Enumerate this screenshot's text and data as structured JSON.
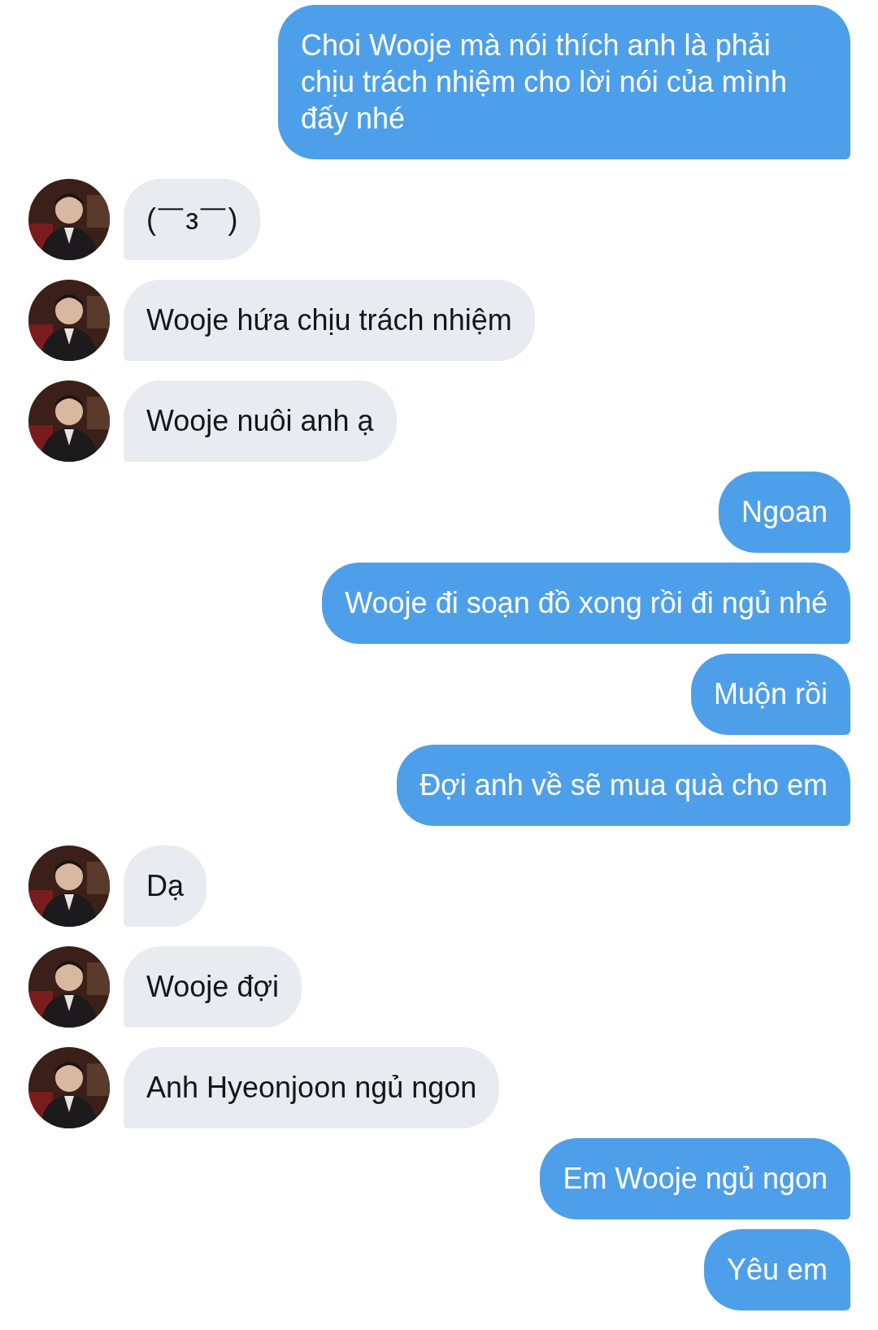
{
  "messages": [
    {
      "kind": "sent",
      "text": "Choi Wooje mà nói thích anh là phải chịu trách nhiệm cho lời nói của mình đấy nhé"
    },
    {
      "kind": "received",
      "text": "(￣з￣)"
    },
    {
      "kind": "received",
      "text": "Wooje hứa chịu trách nhiệm"
    },
    {
      "kind": "received",
      "text": "Wooje nuôi anh ạ"
    },
    {
      "kind": "sent",
      "text": "Ngoan"
    },
    {
      "kind": "sent",
      "text": "Wooje đi soạn đồ xong rồi đi ngủ nhé"
    },
    {
      "kind": "sent",
      "text": "Muộn rồi"
    },
    {
      "kind": "sent",
      "text": "Đợi anh về sẽ mua quà cho em"
    },
    {
      "kind": "received",
      "text": "Dạ"
    },
    {
      "kind": "received",
      "text": "Wooje đợi"
    },
    {
      "kind": "received",
      "text": "Anh Hyeonjoon ngủ ngon"
    },
    {
      "kind": "sent",
      "text": "Em Wooje ngủ ngon"
    },
    {
      "kind": "sent",
      "text": "Yêu em"
    }
  ]
}
